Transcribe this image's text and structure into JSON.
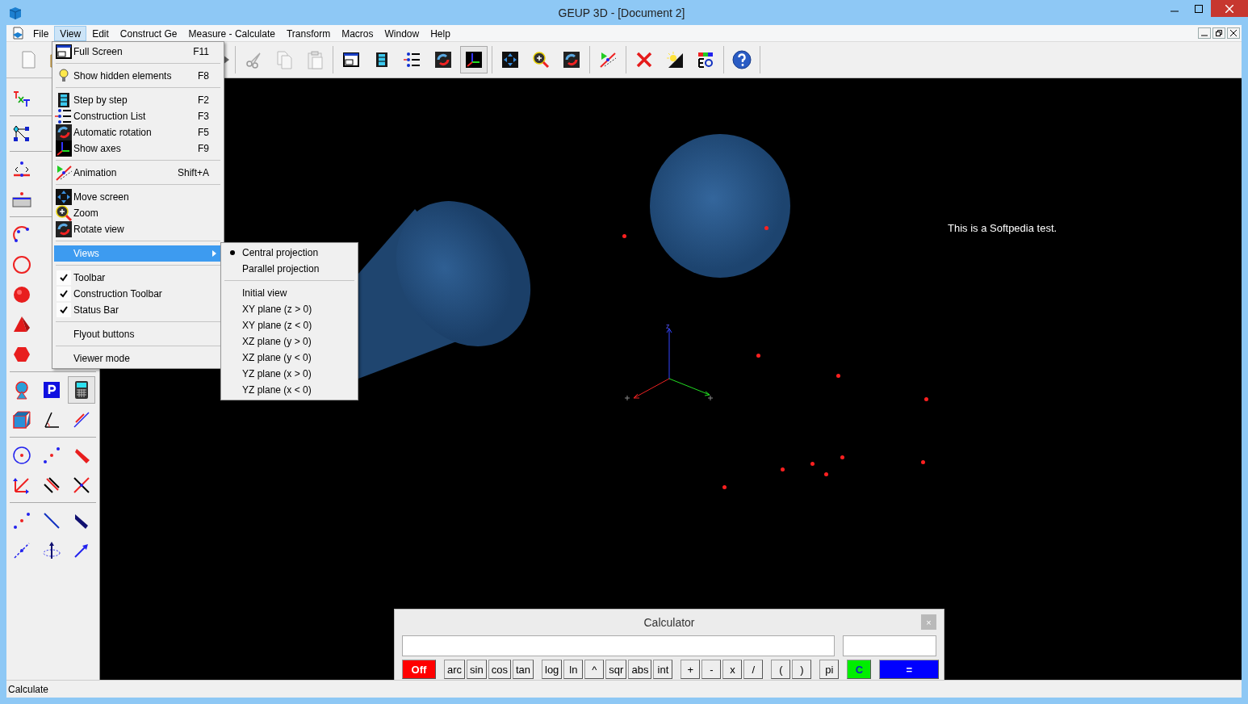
{
  "window": {
    "title": "GEUP 3D - [Document 2]"
  },
  "menu_bar": [
    {
      "label": "File",
      "selected": false
    },
    {
      "label": "View",
      "selected": true
    },
    {
      "label": "Edit",
      "selected": false
    },
    {
      "label": "Construct Ge",
      "selected": false
    },
    {
      "label": "Measure - Calculate",
      "selected": false
    },
    {
      "label": "Transform",
      "selected": false
    },
    {
      "label": "Macros",
      "selected": false
    },
    {
      "label": "Window",
      "selected": false
    },
    {
      "label": "Help",
      "selected": false
    }
  ],
  "view_menu": {
    "items": [
      {
        "kind": "item",
        "label": "Full Screen",
        "shortcut": "F11"
      },
      {
        "kind": "separator"
      },
      {
        "kind": "item",
        "label": "Show hidden elements",
        "shortcut": "F8"
      },
      {
        "kind": "separator"
      },
      {
        "kind": "item",
        "label": "Step by step",
        "shortcut": "F2"
      },
      {
        "kind": "item",
        "label": "Construction List",
        "shortcut": "F3"
      },
      {
        "kind": "item",
        "label": "Automatic rotation",
        "shortcut": "F5"
      },
      {
        "kind": "item",
        "label": "Show axes",
        "shortcut": "F9"
      },
      {
        "kind": "separator"
      },
      {
        "kind": "item",
        "label": "Animation",
        "shortcut": "Shift+A"
      },
      {
        "kind": "separator"
      },
      {
        "kind": "item",
        "label": "Move screen"
      },
      {
        "kind": "item",
        "label": "Zoom"
      },
      {
        "kind": "item",
        "label": "Rotate view"
      },
      {
        "kind": "separator"
      },
      {
        "kind": "submenu",
        "label": "Views",
        "selected": true
      },
      {
        "kind": "separator"
      },
      {
        "kind": "item",
        "label": "Toolbar",
        "checked": true
      },
      {
        "kind": "item",
        "label": "Construction Toolbar",
        "checked": true
      },
      {
        "kind": "item",
        "label": "Status Bar",
        "checked": true
      },
      {
        "kind": "separator"
      },
      {
        "kind": "item",
        "label": "Flyout buttons",
        "checked": false
      },
      {
        "kind": "separator"
      },
      {
        "kind": "item",
        "label": "Viewer mode",
        "checked": false
      }
    ]
  },
  "views_submenu": {
    "items": [
      {
        "kind": "item",
        "label": "Central projection",
        "selected": true
      },
      {
        "kind": "item",
        "label": "Parallel projection",
        "selected": false
      },
      {
        "kind": "separator"
      },
      {
        "kind": "item",
        "label": "Initial view",
        "selected": false
      },
      {
        "kind": "item",
        "label": "XY plane (z > 0)",
        "selected": false
      },
      {
        "kind": "item",
        "label": "XY plane (z < 0)",
        "selected": false
      },
      {
        "kind": "item",
        "label": "XZ plane (y > 0)",
        "selected": false
      },
      {
        "kind": "item",
        "label": "XZ plane (y < 0)",
        "selected": false
      },
      {
        "kind": "item",
        "label": "YZ plane (x > 0)",
        "selected": false
      },
      {
        "kind": "item",
        "label": "YZ plane (x < 0)",
        "selected": false
      }
    ]
  },
  "canvas": {
    "note": "This is a Softpedia test.",
    "axis_label": "z"
  },
  "calculator": {
    "title": "Calculator",
    "close": "×",
    "key_groups": [
      [
        {
          "label": "Off",
          "kind": "off"
        }
      ],
      [
        {
          "label": "arc",
          "kind": "key"
        },
        {
          "label": "sin",
          "kind": "key"
        },
        {
          "label": "cos",
          "kind": "key"
        },
        {
          "label": "tan",
          "kind": "key"
        }
      ],
      [
        {
          "label": "log",
          "kind": "key"
        },
        {
          "label": "ln",
          "kind": "key"
        },
        {
          "label": "^",
          "kind": "key"
        },
        {
          "label": "sqr",
          "kind": "key"
        },
        {
          "label": "abs",
          "kind": "key"
        },
        {
          "label": "int",
          "kind": "key"
        }
      ],
      [
        {
          "label": "+",
          "kind": "key"
        },
        {
          "label": "-",
          "kind": "key"
        },
        {
          "label": "x",
          "kind": "key"
        },
        {
          "label": "/",
          "kind": "key"
        }
      ],
      [
        {
          "label": "(",
          "kind": "key"
        },
        {
          "label": ")",
          "kind": "key"
        }
      ],
      [
        {
          "label": "pi",
          "kind": "key"
        }
      ],
      [
        {
          "label": "C",
          "kind": "clear"
        }
      ],
      [
        {
          "label": "=",
          "kind": "equals"
        }
      ]
    ]
  },
  "status_bar": {
    "text": "Calculate"
  }
}
